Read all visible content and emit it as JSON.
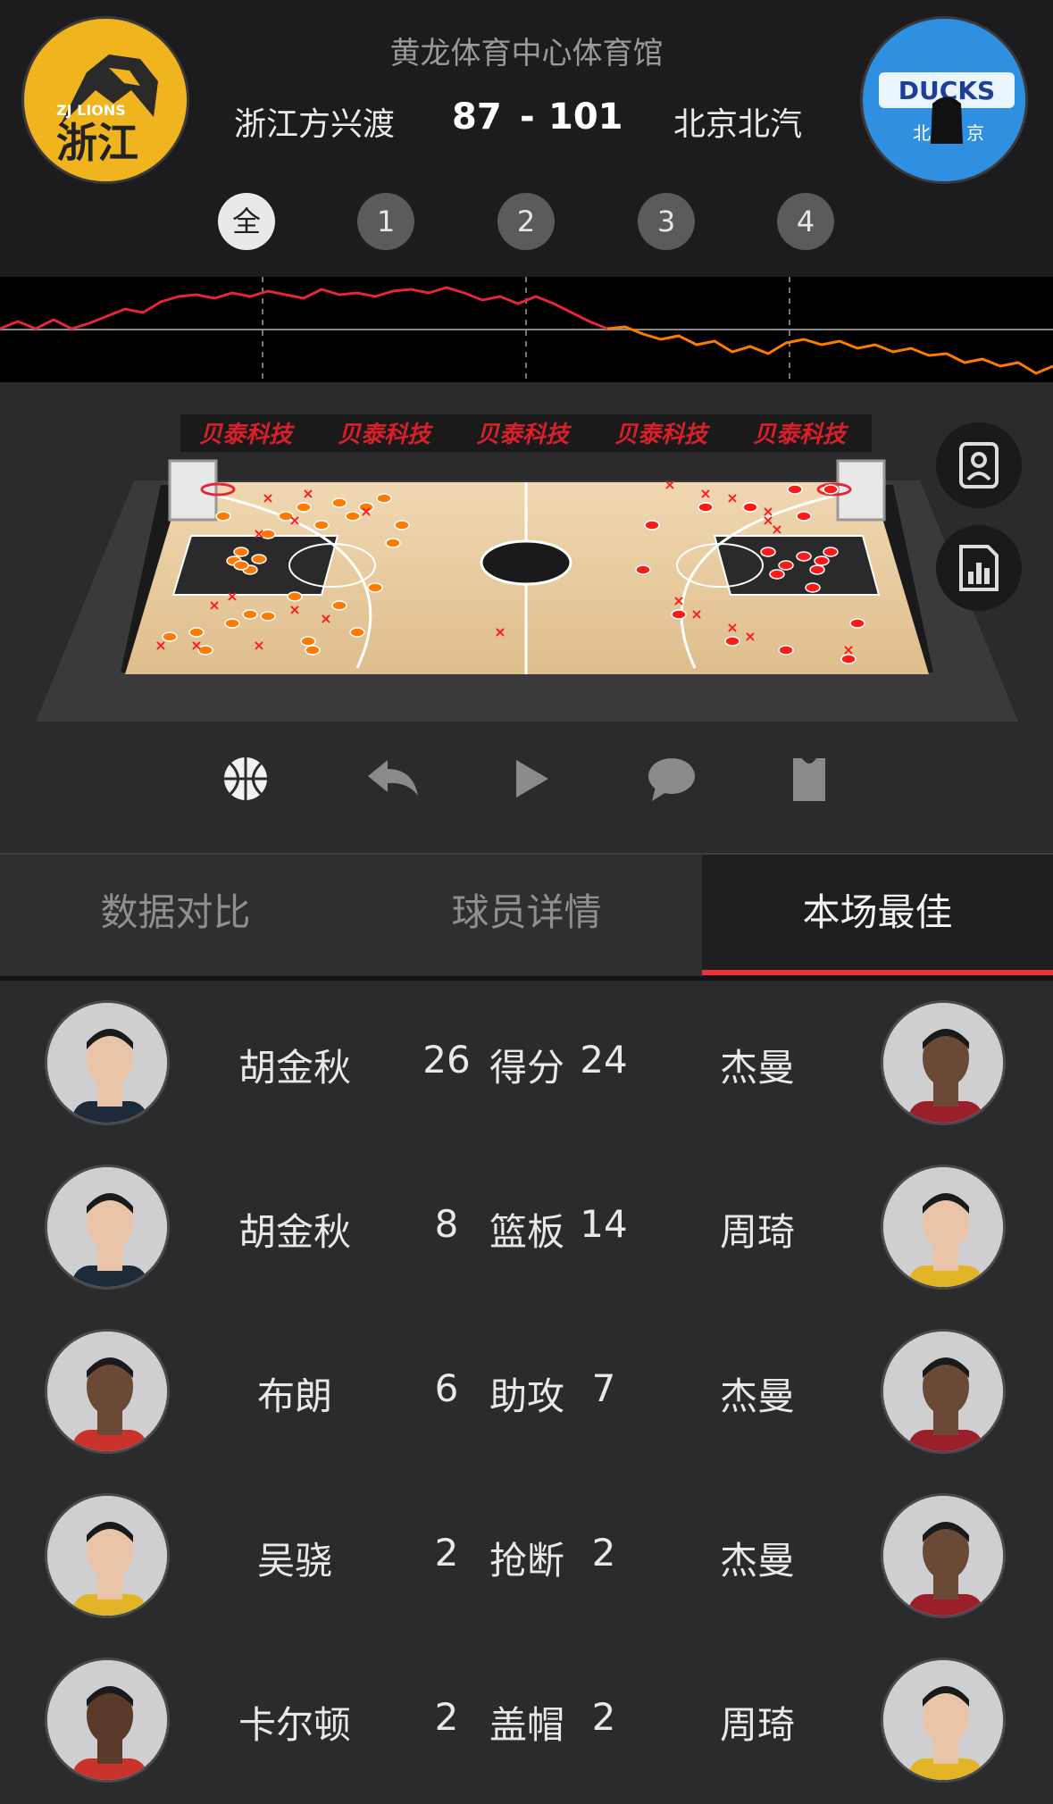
{
  "header": {
    "venue": "黄龙体育中心体育馆",
    "home_team": "浙江方兴渡",
    "away_team": "北京北汽",
    "home_score": "87",
    "score_sep": "-",
    "away_score": "101",
    "home_logo": {
      "top": "ZJ LIONS",
      "main": "浙江"
    },
    "away_logo": {
      "top": "DUCKS",
      "left": "北",
      "right": "京"
    }
  },
  "quarters": [
    "全",
    "1",
    "2",
    "3",
    "4"
  ],
  "selected_quarter": "全",
  "court": {
    "ad_boards": [
      "贝泰科技",
      "贝泰科技",
      "贝泰科技",
      "贝泰科技",
      "贝泰科技"
    ],
    "home_shot_color": "#ff7a00",
    "away_shot_color": "#ff1a1a"
  },
  "toolbar": [
    "basketball-icon",
    "undo-icon",
    "play-icon",
    "comment-icon",
    "jersey-icon"
  ],
  "tabs": [
    "数据对比",
    "球员详情",
    "本场最佳"
  ],
  "active_tab": "本场最佳",
  "accent_color": "#e8343a",
  "best": [
    {
      "left_player": "胡金秋",
      "left_value": "26",
      "label": "得分",
      "right_value": "24",
      "right_player": "杰曼"
    },
    {
      "left_player": "胡金秋",
      "left_value": "8",
      "label": "篮板",
      "right_value": "14",
      "right_player": "周琦"
    },
    {
      "left_player": "布朗",
      "left_value": "6",
      "label": "助攻",
      "right_value": "7",
      "right_player": "杰曼"
    },
    {
      "left_player": "吴骁",
      "left_value": "2",
      "label": "抢断",
      "right_value": "2",
      "right_player": "杰曼"
    },
    {
      "left_player": "卡尔顿",
      "left_value": "2",
      "label": "盖帽",
      "right_value": "2",
      "right_player": "周琦"
    }
  ]
}
